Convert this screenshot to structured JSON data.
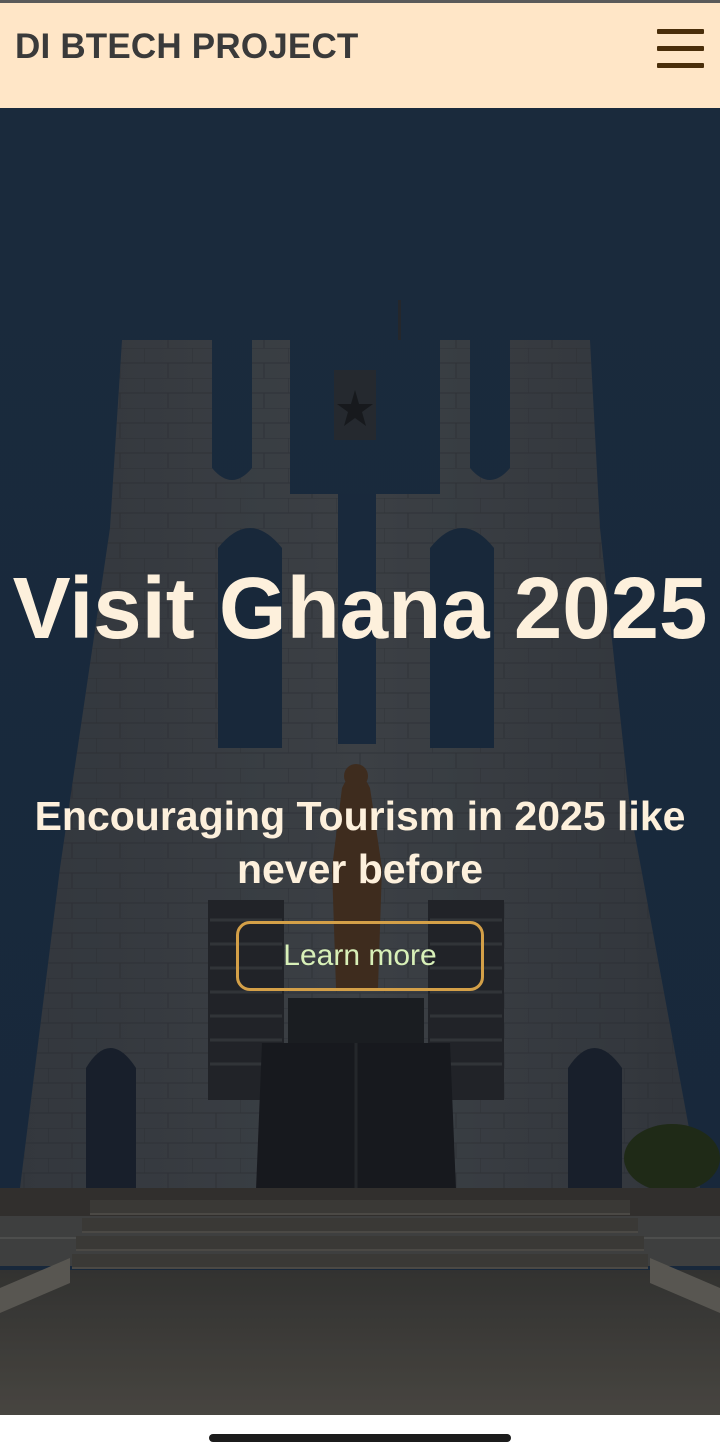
{
  "header": {
    "brand": "DI BTECH PROJECT",
    "menu_icon": "hamburger-menu-icon",
    "background": "#ffe6c7"
  },
  "hero": {
    "background_image": "mausoleum-monument-photo",
    "title": "Visit Ghana 2025",
    "subtitle": "Encouraging Tourism in 2025 like never before",
    "cta_label": "Learn more",
    "cta_border_color": "#d4a048",
    "text_color": "#fdf0dc"
  },
  "system": {
    "home_indicator": "home-indicator"
  }
}
